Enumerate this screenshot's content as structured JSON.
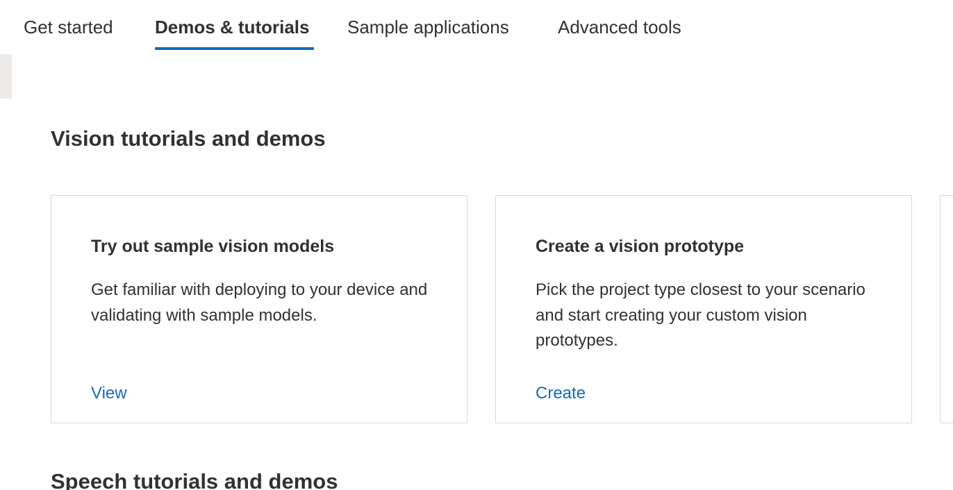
{
  "tabs": [
    {
      "label": "Get started",
      "active": false
    },
    {
      "label": "Demos & tutorials",
      "active": true
    },
    {
      "label": "Sample applications",
      "active": false
    },
    {
      "label": "Advanced tools",
      "active": false
    }
  ],
  "sections": {
    "vision": {
      "title": "Vision tutorials and demos",
      "cards": [
        {
          "title": "Try out sample vision models",
          "description": "Get familiar with deploying to your device and validating with sample models.",
          "link": "View"
        },
        {
          "title": "Create a vision prototype",
          "description": "Pick the project type closest to your scenario and start creating your custom vision prototypes.",
          "link": "Create"
        }
      ]
    },
    "speech": {
      "title": "Speech tutorials and demos"
    }
  },
  "colors": {
    "accent": "#0f6cbd",
    "text": "#323130",
    "border": "#d6d6d6"
  }
}
